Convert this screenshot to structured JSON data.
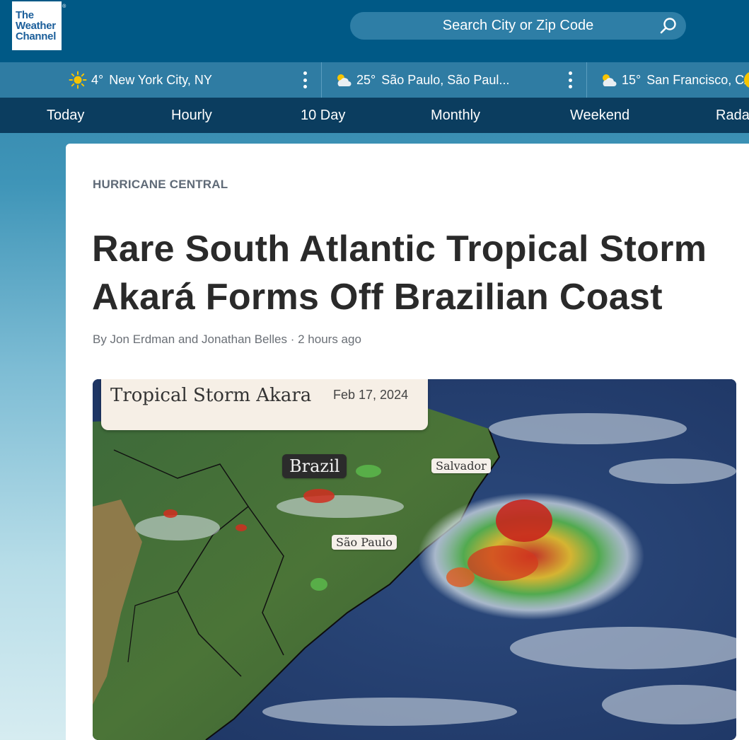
{
  "header": {
    "logo_line1": "The",
    "logo_line2": "Weather",
    "logo_line3": "Channel",
    "logo_mark": "®",
    "search_placeholder": "Search City or Zip Code"
  },
  "locations": [
    {
      "temp": "4°",
      "name": "New York City, NY",
      "icon": "sun-icon"
    },
    {
      "temp": "25°",
      "name": "São Paulo, São Paul...",
      "icon": "partly-cloudy-icon"
    },
    {
      "temp": "15°",
      "name": "San Francisco, CA",
      "icon": "partly-cloudy-icon"
    }
  ],
  "nav": [
    "Today",
    "Hourly",
    "10 Day",
    "Monthly",
    "Weekend",
    "Radar"
  ],
  "article": {
    "kicker": "HURRICANE CENTRAL",
    "headline_line1": "Rare South Atlantic Tropical Storm",
    "headline_line2": "Akará Forms Off Brazilian Coast",
    "byline": "By Jon Erdman and Jonathan Belles · 2 hours ago"
  },
  "image": {
    "title": "Tropical Storm Akara",
    "date": "Feb 17, 2024",
    "labels": {
      "brazil": "Brazil",
      "salvador": "Salvador",
      "sao_paulo": "São Paulo"
    }
  },
  "colors": {
    "header_bg": "#005986",
    "location_bar_bg": "#2f7ca3",
    "nav_bg": "#0b3d5f",
    "headline": "#2a2a2a"
  }
}
